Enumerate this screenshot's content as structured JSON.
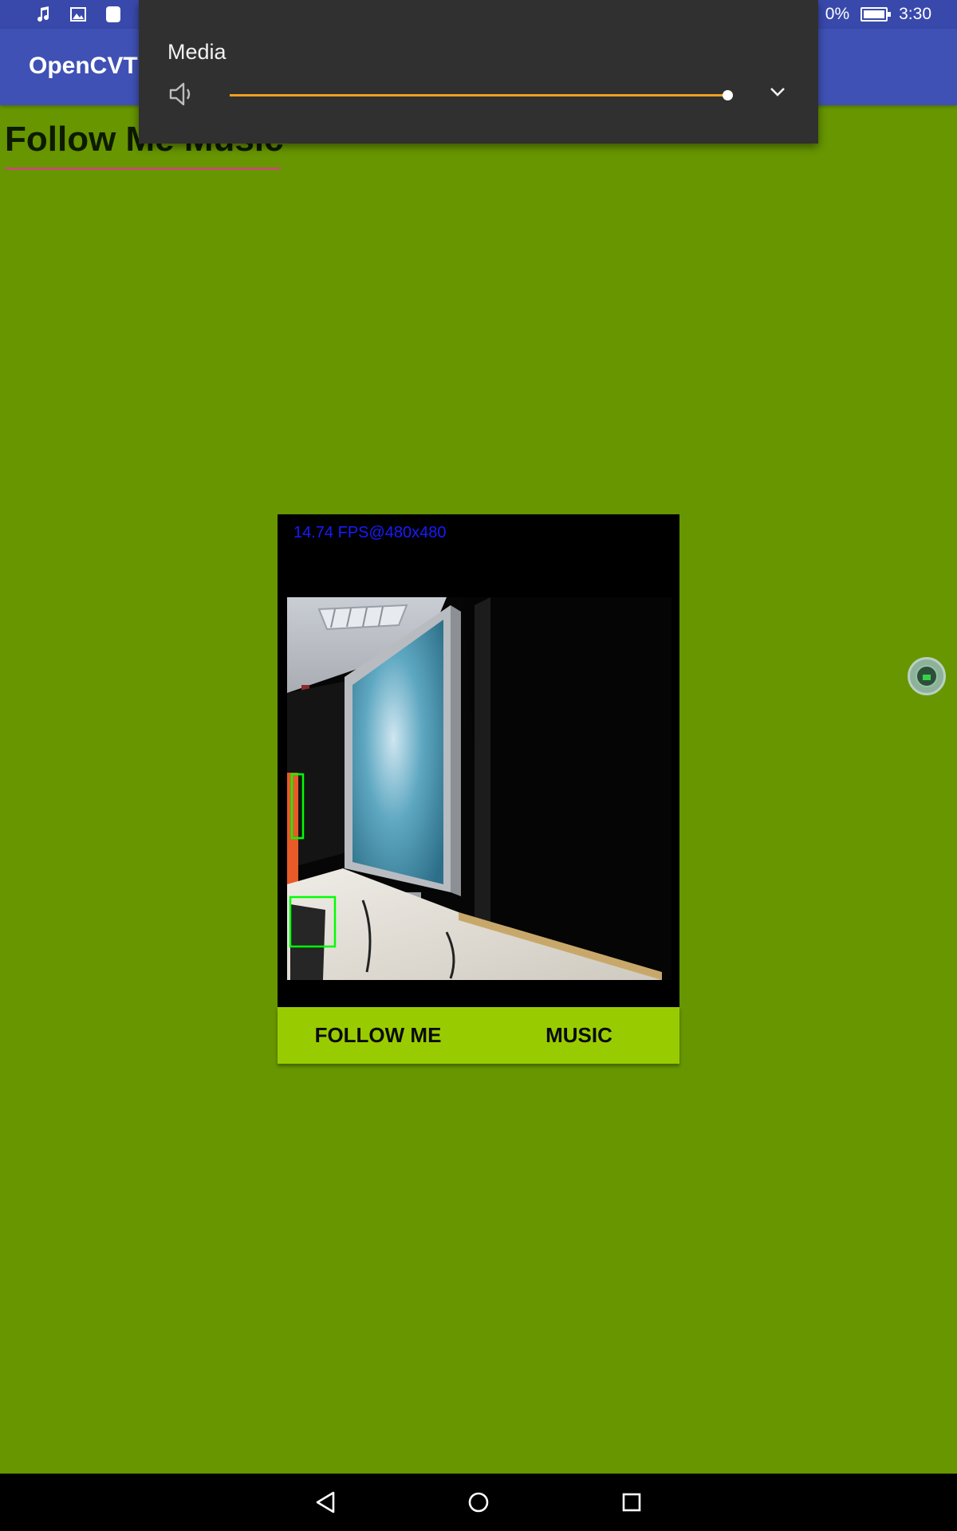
{
  "status_bar": {
    "icons": [
      "music-note-icon",
      "image-icon",
      "app-notification-icon"
    ],
    "battery_percent_text": "0%",
    "time": "3:30"
  },
  "app_bar": {
    "title": "OpenCVTE"
  },
  "page": {
    "heading": "Follow Me Music"
  },
  "volume_panel": {
    "title": "Media",
    "level": 1.0,
    "icon": "speaker-icon",
    "expand_icon": "chevron-down-icon",
    "accent_color": "#f0a020"
  },
  "camera": {
    "fps_text": "14.74 FPS@480x480"
  },
  "buttons": {
    "follow_me": "FOLLOW ME",
    "music": "MUSIC"
  },
  "nav": {
    "icons": [
      "back-icon",
      "home-icon",
      "recents-icon"
    ]
  },
  "colors": {
    "background": "#679600",
    "app_bar": "#3f51b5",
    "button_bar": "#99cc00",
    "detection_box": "#00ff00"
  }
}
